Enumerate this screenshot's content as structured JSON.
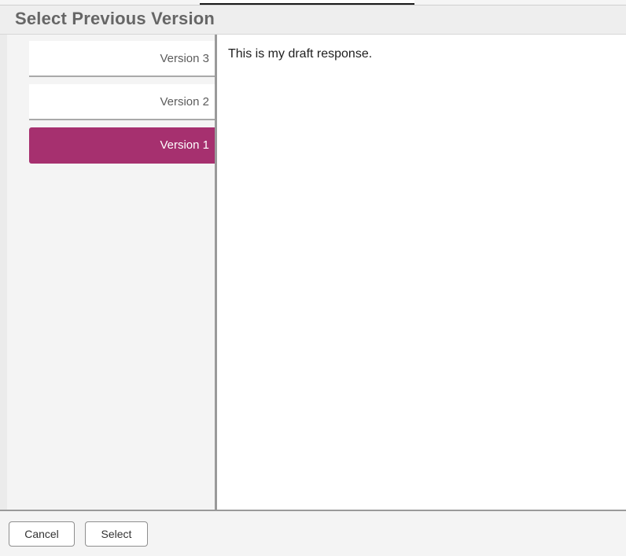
{
  "dialog": {
    "title": "Select Previous Version"
  },
  "versions": [
    {
      "label": "Version 3",
      "selected": false
    },
    {
      "label": "Version 2",
      "selected": false
    },
    {
      "label": "Version 1",
      "selected": true
    }
  ],
  "preview": {
    "text": "This is my draft response."
  },
  "footer": {
    "cancel_label": "Cancel",
    "select_label": "Select"
  },
  "colors": {
    "selected_tab": "#a6306f",
    "title_text": "#666666"
  }
}
